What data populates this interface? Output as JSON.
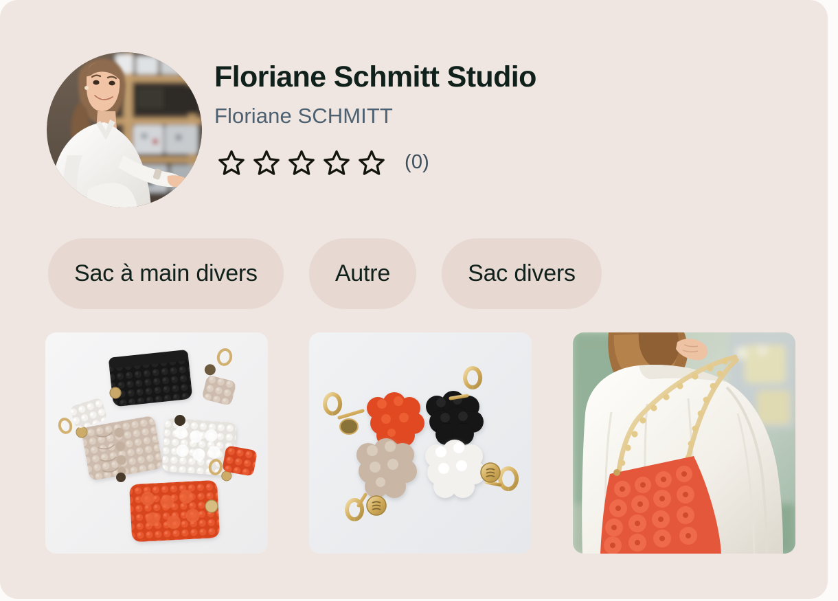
{
  "card": {
    "background_color": "#efe5e1",
    "page_background_color": "#fdfbfa"
  },
  "profile": {
    "avatar_alt": "avatar-photo-woman-in-white-shirt-in-workshop",
    "shop_name": "Floriane Schmitt Studio",
    "owner_name": "Floriane SCHMITT",
    "rating": {
      "value": 0,
      "max": 5,
      "star_icon": "star-outline-icon",
      "filled_count": 0,
      "count_label": "(0)",
      "star_color": "#14150f",
      "count_color": "#3d4f5c"
    }
  },
  "tags": [
    {
      "label": "Sac à main divers"
    },
    {
      "label": "Autre"
    },
    {
      "label": "Sac divers"
    }
  ],
  "tag_style": {
    "background_color": "#e7d8d2",
    "text_color": "#10201a"
  },
  "gallery": [
    {
      "alt": "flatlay-of-handmade-textured-clutch-bags-black-beige-white-and-red-with-keychain-charms",
      "background_color": "#f3f3f4"
    },
    {
      "alt": "four-handmade-ruffled-keychain-charms-red-black-beige-white-with-gold-clasps",
      "background_color": "#eef0f2"
    },
    {
      "alt": "model-in-white-coat-wearing-coral-ruffled-bag-with-gold-chain-strap",
      "background_color": "#cfd9cc"
    }
  ]
}
